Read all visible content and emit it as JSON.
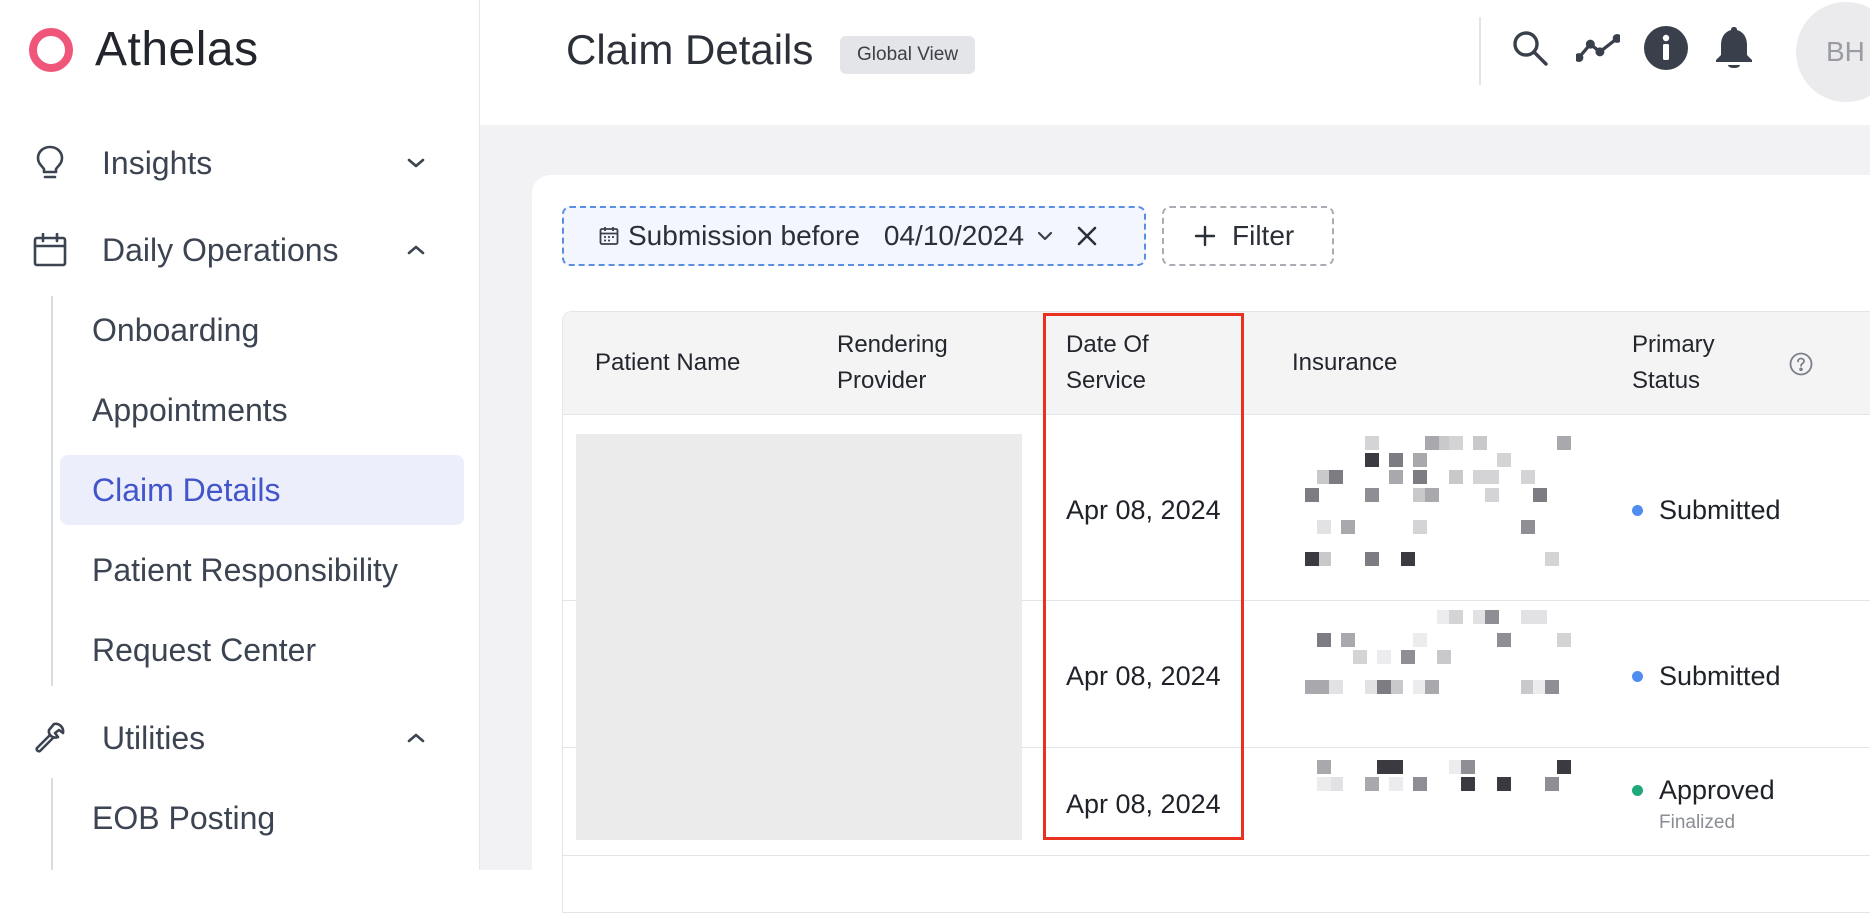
{
  "brand": {
    "name": "Athelas",
    "logo_color": "#f0557a"
  },
  "sidebar": {
    "sections": [
      {
        "label": "Insights",
        "icon": "lightbulb-icon",
        "expanded": false
      },
      {
        "label": "Daily Operations",
        "icon": "calendar-icon",
        "expanded": true,
        "items": [
          "Onboarding",
          "Appointments",
          "Claim Details",
          "Patient Responsibility",
          "Request Center"
        ],
        "active_item": "Claim Details"
      },
      {
        "label": "Utilities",
        "icon": "wrench-icon",
        "expanded": true,
        "items": [
          "EOB Posting"
        ]
      }
    ]
  },
  "header": {
    "title": "Claim Details",
    "badge": "Global View",
    "icons": [
      "search-icon",
      "trend-icon",
      "info-icon",
      "bell-icon"
    ],
    "avatar_initials": "BH"
  },
  "filters": {
    "date_filter": {
      "label": "Submission before",
      "value": "04/10/2024"
    },
    "add_filter_label": "Filter"
  },
  "table": {
    "columns": {
      "patient_name": "Patient Name",
      "rendering_provider_line1": "Rendering",
      "rendering_provider_line2": "Provider",
      "date_of_service_line1": "Date Of",
      "date_of_service_line2": "Service",
      "insurance": "Insurance",
      "primary_status_line1": "Primary",
      "primary_status_line2": "Status"
    },
    "rows": [
      {
        "date_of_service": "Apr 08, 2024",
        "status": "Submitted",
        "status_color": "#4f8ef0",
        "substatus": ""
      },
      {
        "date_of_service": "Apr 08, 2024",
        "status": "Submitted",
        "status_color": "#4f8ef0",
        "substatus": ""
      },
      {
        "date_of_service": "Apr 08, 2024",
        "status": "Approved",
        "status_color": "#1fa878",
        "substatus": "Finalized"
      }
    ]
  },
  "colors": {
    "accent": "#4256c9",
    "highlight": "#e8321f"
  }
}
